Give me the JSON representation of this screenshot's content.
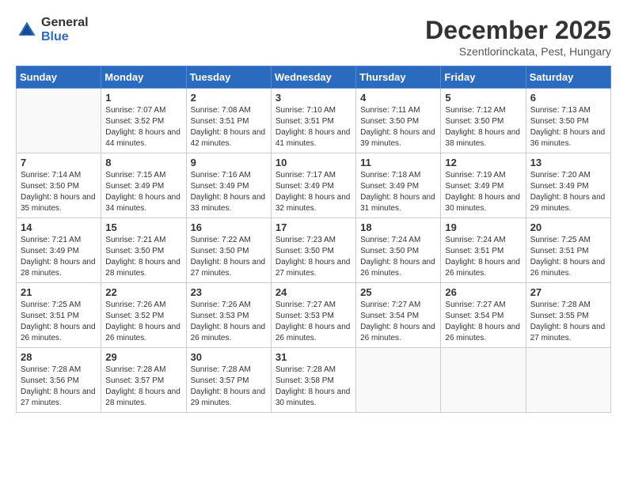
{
  "logo": {
    "general": "General",
    "blue": "Blue"
  },
  "title": {
    "month": "December 2025",
    "location": "Szentlorinckata, Pest, Hungary"
  },
  "days_of_week": [
    "Sunday",
    "Monday",
    "Tuesday",
    "Wednesday",
    "Thursday",
    "Friday",
    "Saturday"
  ],
  "weeks": [
    [
      {
        "day": "",
        "info": ""
      },
      {
        "day": "1",
        "info": "Sunrise: 7:07 AM\nSunset: 3:52 PM\nDaylight: 8 hours\nand 44 minutes."
      },
      {
        "day": "2",
        "info": "Sunrise: 7:08 AM\nSunset: 3:51 PM\nDaylight: 8 hours\nand 42 minutes."
      },
      {
        "day": "3",
        "info": "Sunrise: 7:10 AM\nSunset: 3:51 PM\nDaylight: 8 hours\nand 41 minutes."
      },
      {
        "day": "4",
        "info": "Sunrise: 7:11 AM\nSunset: 3:50 PM\nDaylight: 8 hours\nand 39 minutes."
      },
      {
        "day": "5",
        "info": "Sunrise: 7:12 AM\nSunset: 3:50 PM\nDaylight: 8 hours\nand 38 minutes."
      },
      {
        "day": "6",
        "info": "Sunrise: 7:13 AM\nSunset: 3:50 PM\nDaylight: 8 hours\nand 36 minutes."
      }
    ],
    [
      {
        "day": "7",
        "info": "Sunrise: 7:14 AM\nSunset: 3:50 PM\nDaylight: 8 hours\nand 35 minutes."
      },
      {
        "day": "8",
        "info": "Sunrise: 7:15 AM\nSunset: 3:49 PM\nDaylight: 8 hours\nand 34 minutes."
      },
      {
        "day": "9",
        "info": "Sunrise: 7:16 AM\nSunset: 3:49 PM\nDaylight: 8 hours\nand 33 minutes."
      },
      {
        "day": "10",
        "info": "Sunrise: 7:17 AM\nSunset: 3:49 PM\nDaylight: 8 hours\nand 32 minutes."
      },
      {
        "day": "11",
        "info": "Sunrise: 7:18 AM\nSunset: 3:49 PM\nDaylight: 8 hours\nand 31 minutes."
      },
      {
        "day": "12",
        "info": "Sunrise: 7:19 AM\nSunset: 3:49 PM\nDaylight: 8 hours\nand 30 minutes."
      },
      {
        "day": "13",
        "info": "Sunrise: 7:20 AM\nSunset: 3:49 PM\nDaylight: 8 hours\nand 29 minutes."
      }
    ],
    [
      {
        "day": "14",
        "info": "Sunrise: 7:21 AM\nSunset: 3:49 PM\nDaylight: 8 hours\nand 28 minutes."
      },
      {
        "day": "15",
        "info": "Sunrise: 7:21 AM\nSunset: 3:50 PM\nDaylight: 8 hours\nand 28 minutes."
      },
      {
        "day": "16",
        "info": "Sunrise: 7:22 AM\nSunset: 3:50 PM\nDaylight: 8 hours\nand 27 minutes."
      },
      {
        "day": "17",
        "info": "Sunrise: 7:23 AM\nSunset: 3:50 PM\nDaylight: 8 hours\nand 27 minutes."
      },
      {
        "day": "18",
        "info": "Sunrise: 7:24 AM\nSunset: 3:50 PM\nDaylight: 8 hours\nand 26 minutes."
      },
      {
        "day": "19",
        "info": "Sunrise: 7:24 AM\nSunset: 3:51 PM\nDaylight: 8 hours\nand 26 minutes."
      },
      {
        "day": "20",
        "info": "Sunrise: 7:25 AM\nSunset: 3:51 PM\nDaylight: 8 hours\nand 26 minutes."
      }
    ],
    [
      {
        "day": "21",
        "info": "Sunrise: 7:25 AM\nSunset: 3:51 PM\nDaylight: 8 hours\nand 26 minutes."
      },
      {
        "day": "22",
        "info": "Sunrise: 7:26 AM\nSunset: 3:52 PM\nDaylight: 8 hours\nand 26 minutes."
      },
      {
        "day": "23",
        "info": "Sunrise: 7:26 AM\nSunset: 3:53 PM\nDaylight: 8 hours\nand 26 minutes."
      },
      {
        "day": "24",
        "info": "Sunrise: 7:27 AM\nSunset: 3:53 PM\nDaylight: 8 hours\nand 26 minutes."
      },
      {
        "day": "25",
        "info": "Sunrise: 7:27 AM\nSunset: 3:54 PM\nDaylight: 8 hours\nand 26 minutes."
      },
      {
        "day": "26",
        "info": "Sunrise: 7:27 AM\nSunset: 3:54 PM\nDaylight: 8 hours\nand 26 minutes."
      },
      {
        "day": "27",
        "info": "Sunrise: 7:28 AM\nSunset: 3:55 PM\nDaylight: 8 hours\nand 27 minutes."
      }
    ],
    [
      {
        "day": "28",
        "info": "Sunrise: 7:28 AM\nSunset: 3:56 PM\nDaylight: 8 hours\nand 27 minutes."
      },
      {
        "day": "29",
        "info": "Sunrise: 7:28 AM\nSunset: 3:57 PM\nDaylight: 8 hours\nand 28 minutes."
      },
      {
        "day": "30",
        "info": "Sunrise: 7:28 AM\nSunset: 3:57 PM\nDaylight: 8 hours\nand 29 minutes."
      },
      {
        "day": "31",
        "info": "Sunrise: 7:28 AM\nSunset: 3:58 PM\nDaylight: 8 hours\nand 30 minutes."
      },
      {
        "day": "",
        "info": ""
      },
      {
        "day": "",
        "info": ""
      },
      {
        "day": "",
        "info": ""
      }
    ]
  ]
}
